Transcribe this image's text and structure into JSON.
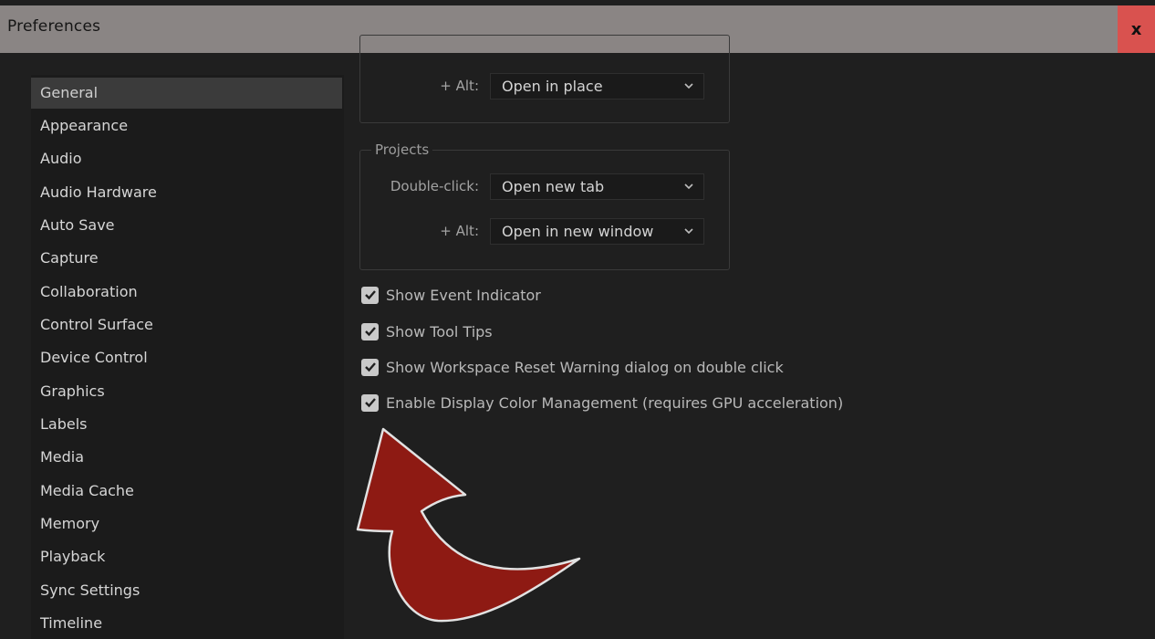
{
  "window": {
    "title": "Preferences",
    "close_label": "x"
  },
  "sidebar": {
    "items": [
      {
        "label": "General",
        "selected": true
      },
      {
        "label": "Appearance"
      },
      {
        "label": "Audio"
      },
      {
        "label": "Audio Hardware"
      },
      {
        "label": "Auto Save"
      },
      {
        "label": "Capture"
      },
      {
        "label": "Collaboration"
      },
      {
        "label": "Control Surface"
      },
      {
        "label": "Device Control"
      },
      {
        "label": "Graphics"
      },
      {
        "label": "Labels"
      },
      {
        "label": "Media"
      },
      {
        "label": "Media Cache"
      },
      {
        "label": "Memory"
      },
      {
        "label": "Playback"
      },
      {
        "label": "Sync Settings"
      },
      {
        "label": "Timeline"
      }
    ]
  },
  "sequences_group": {
    "alt_label": "+ Alt:",
    "alt_value": "Open in place"
  },
  "projects_group": {
    "title": "Projects",
    "double_click_label": "Double-click:",
    "double_click_value": "Open new tab",
    "alt_label": "+ Alt:",
    "alt_value": "Open in new window"
  },
  "checkboxes": [
    {
      "label": "Show Event Indicator",
      "checked": true
    },
    {
      "label": "Show Tool Tips",
      "checked": true
    },
    {
      "label": "Show Workspace Reset Warning dialog on double click",
      "checked": true
    },
    {
      "label": "Enable Display Color Management (requires GPU acceleration)",
      "checked": true
    }
  ],
  "colors": {
    "background": "#1f1f1f",
    "titlebar": "#8a8584",
    "close_button": "#d9524f",
    "sidebar_selected": "#3b3b3b",
    "arrow_fill": "#8e1a13"
  }
}
